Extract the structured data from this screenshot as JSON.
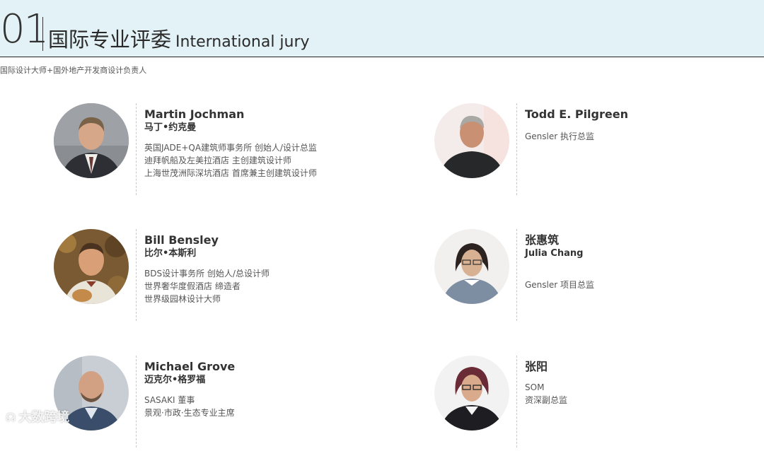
{
  "header": {
    "number": "01",
    "title_cn": "国际专业评委",
    "title_en": "International jury"
  },
  "subtitle": "国际设计大师+国外地产开发商设计负责人",
  "jurors": [
    {
      "name": "Martin Jochman",
      "alt_name": "马丁•约克曼",
      "lines": [
        "英国JADE+QA建筑师事务所 创始人/设计总监",
        "迪拜帆船及左美拉酒店 主创建筑设计师",
        "上海世茂洲际深坑酒店 首席兼主创建筑设计师"
      ]
    },
    {
      "name": "Todd E. Pilgreen",
      "alt_name": "",
      "lines": [
        "Gensler 执行总监"
      ]
    },
    {
      "name": "Bill Bensley",
      "alt_name": "比尔•本斯利",
      "lines": [
        "BDS设计事务所 创始人/总设计师",
        "世界奢华度假酒店 缔造者",
        "世界级园林设计大师"
      ]
    },
    {
      "name": "张惠筑",
      "alt_name": "Julia Chang",
      "lines": [
        "Gensler 项目总监"
      ]
    },
    {
      "name": "Michael Grove",
      "alt_name": "迈克尔•格罗福",
      "lines": [
        "SASAKI 董事",
        "景观·市政·生态专业主席"
      ]
    },
    {
      "name": "张阳",
      "alt_name": "",
      "lines": [
        "SOM",
        "资深副总监"
      ]
    }
  ],
  "watermark": "大数跨境",
  "colors": {
    "header_bg": "#e3f2f7",
    "text": "#333333",
    "divider": "#c8c8c8"
  }
}
